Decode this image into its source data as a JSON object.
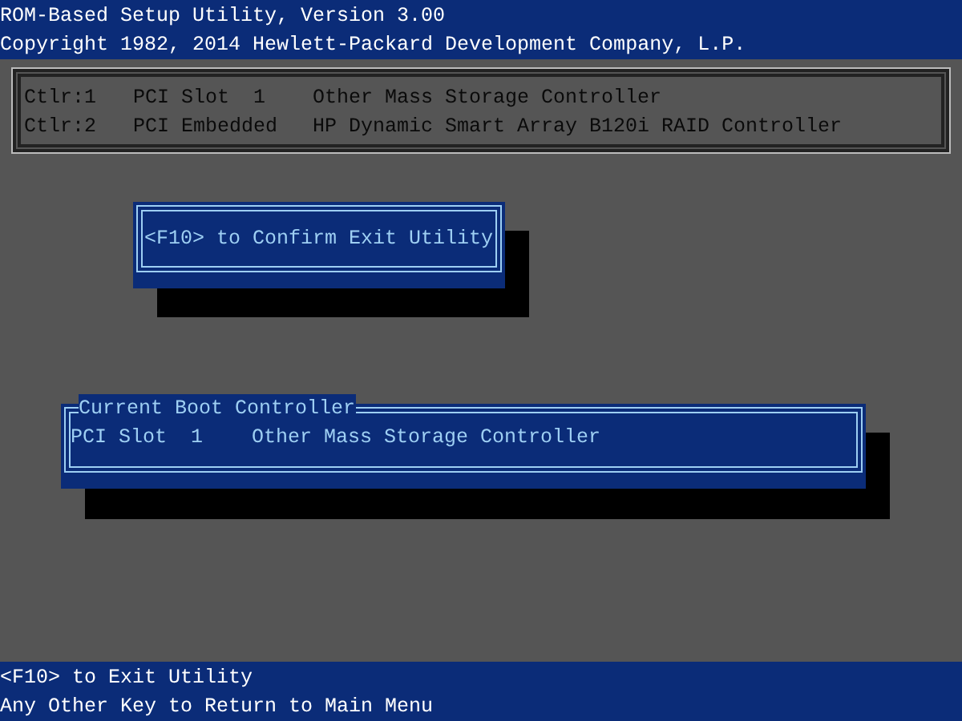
{
  "header": {
    "title": "ROM-Based Setup Utility, Version 3.00",
    "copyright": "Copyright 1982, 2014 Hewlett-Packard Development Company, L.P."
  },
  "controllers": [
    {
      "id": "Ctlr:1",
      "location": "PCI Slot  1",
      "description": "Other Mass Storage Controller"
    },
    {
      "id": "Ctlr:2",
      "location": "PCI Embedded",
      "description": "HP Dynamic Smart Array B120i RAID Controller"
    }
  ],
  "confirm_dialog": {
    "message": "<F10> to Confirm Exit Utility"
  },
  "boot_controller": {
    "title": "Current Boot Controller",
    "location": "PCI Slot  1",
    "description": "Other Mass Storage Controller"
  },
  "footer": [
    "<F10> to Exit Utility",
    "Any Other Key to Return to Main Menu"
  ]
}
